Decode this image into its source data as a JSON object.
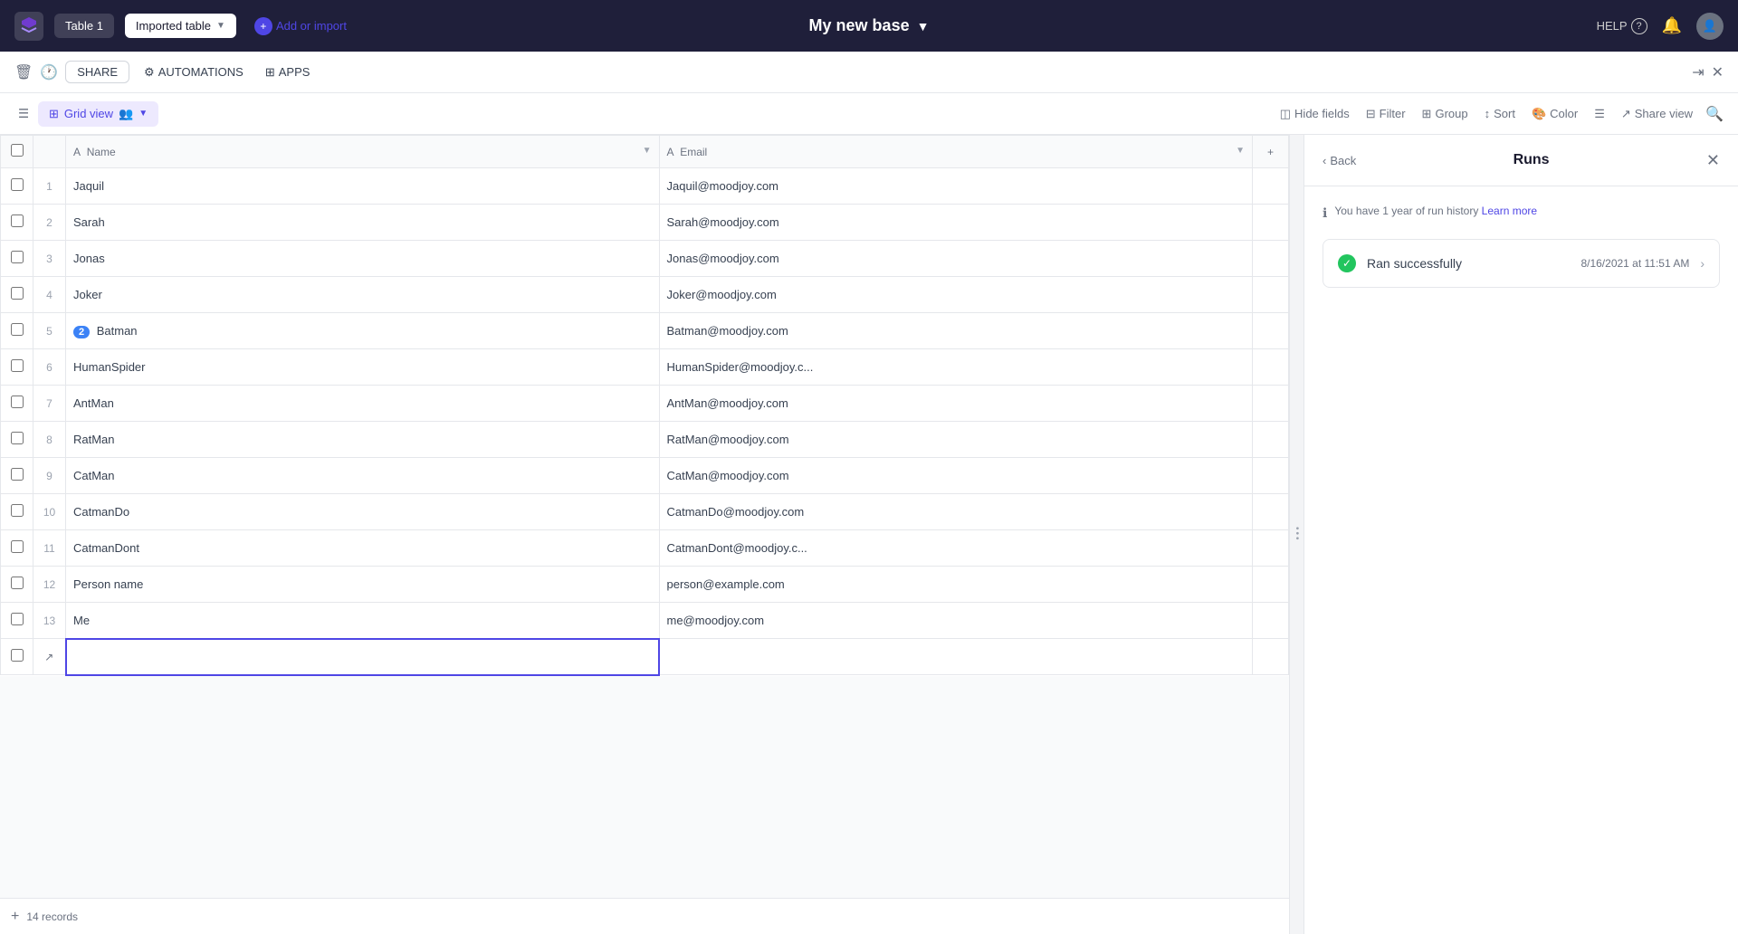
{
  "topbar": {
    "title": "My new base",
    "title_caret": "▼",
    "tab_table1": "Table 1",
    "tab_imported": "Imported table",
    "tab_caret": "▼",
    "add_or_import": "Add or import",
    "help": "HELP",
    "share_label": "SHARE",
    "automations_label": "AUTOMATIONS",
    "apps_label": "APPS"
  },
  "toolbar": {
    "grid_view": "Grid view",
    "hide_fields": "Hide fields",
    "filter": "Filter",
    "group": "Group",
    "sort": "Sort",
    "color": "Color",
    "share_view": "Share view"
  },
  "columns": {
    "name": "Name",
    "email": "Email"
  },
  "rows": [
    {
      "id": 1,
      "name": "Jaquil",
      "email": "Jaquil@moodjoy.com",
      "badge": null
    },
    {
      "id": 2,
      "name": "Sarah",
      "email": "Sarah@moodjoy.com",
      "badge": null
    },
    {
      "id": 3,
      "name": "Jonas",
      "email": "Jonas@moodjoy.com",
      "badge": null
    },
    {
      "id": 4,
      "name": "Joker",
      "email": "Joker@moodjoy.com",
      "badge": null
    },
    {
      "id": 5,
      "name": "Batman",
      "email": "Batman@moodjoy.com",
      "badge": "2"
    },
    {
      "id": 6,
      "name": "HumanSpider",
      "email": "HumanSpider@moodjoy.c...",
      "badge": null
    },
    {
      "id": 7,
      "name": "AntMan",
      "email": "AntMan@moodjoy.com",
      "badge": null
    },
    {
      "id": 8,
      "name": "RatMan",
      "email": "RatMan@moodjoy.com",
      "badge": null
    },
    {
      "id": 9,
      "name": "CatMan",
      "email": "CatMan@moodjoy.com",
      "badge": null
    },
    {
      "id": 10,
      "name": "CatmanDo",
      "email": "CatmanDo@moodjoy.com",
      "badge": null
    },
    {
      "id": 11,
      "name": "CatmanDont",
      "email": "CatmanDont@moodjoy.c...",
      "badge": null
    },
    {
      "id": 12,
      "name": "Person name",
      "email": "person@example.com",
      "badge": null
    },
    {
      "id": 13,
      "name": "Me",
      "email": "me@moodjoy.com",
      "badge": null
    }
  ],
  "footer": {
    "record_count": "14 records"
  },
  "right_panel": {
    "back": "Back",
    "title": "Runs",
    "info_text": "You have 1 year of run history",
    "learn_more": "Learn more",
    "run_label": "Ran successfully",
    "run_time": "8/16/2021 at 11:51 AM",
    "run_chevron": "›"
  }
}
